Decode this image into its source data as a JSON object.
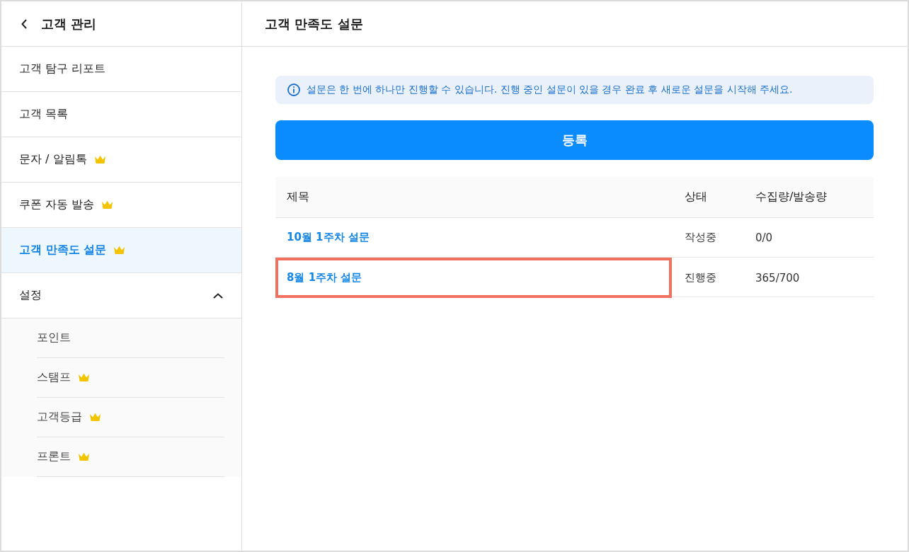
{
  "sidebar": {
    "title": "고객 관리",
    "items": [
      {
        "kind": "link",
        "label": "고객 탐구 리포트",
        "premium": false,
        "selected": false
      },
      {
        "kind": "link",
        "label": "고객 목록",
        "premium": false,
        "selected": false
      },
      {
        "kind": "link",
        "label": "문자 / 알림톡",
        "premium": true,
        "selected": false
      },
      {
        "kind": "link",
        "label": "쿠폰 자동 발송",
        "premium": true,
        "selected": false
      },
      {
        "kind": "link",
        "label": "고객 만족도 설문",
        "premium": true,
        "selected": true
      },
      {
        "kind": "group",
        "label": "설정",
        "premium": false,
        "selected": false,
        "expanded": true,
        "children": [
          {
            "label": "포인트",
            "premium": false,
            "selected": false
          },
          {
            "label": "스탬프",
            "premium": true,
            "selected": false
          },
          {
            "label": "고객등급",
            "premium": true,
            "selected": false
          },
          {
            "label": "프론트",
            "premium": true,
            "selected": false
          }
        ]
      }
    ]
  },
  "main": {
    "title": "고객 만족도 설문",
    "notice": "설문은 한 번에 하나만 진행할 수 있습니다. 진행 중인 설문이 있을 경우 완료 후 새로운 설문을 시작해 주세요.",
    "register_button": "등록",
    "table": {
      "columns": [
        "제목",
        "상태",
        "수집량/발송량"
      ],
      "rows": [
        {
          "title": "10월 1주차 설문",
          "status": "작성중",
          "count": "0/0",
          "highlighted": false
        },
        {
          "title": "8월 1주차 설문",
          "status": "진행중",
          "count": "365/700",
          "highlighted": true
        }
      ]
    }
  }
}
